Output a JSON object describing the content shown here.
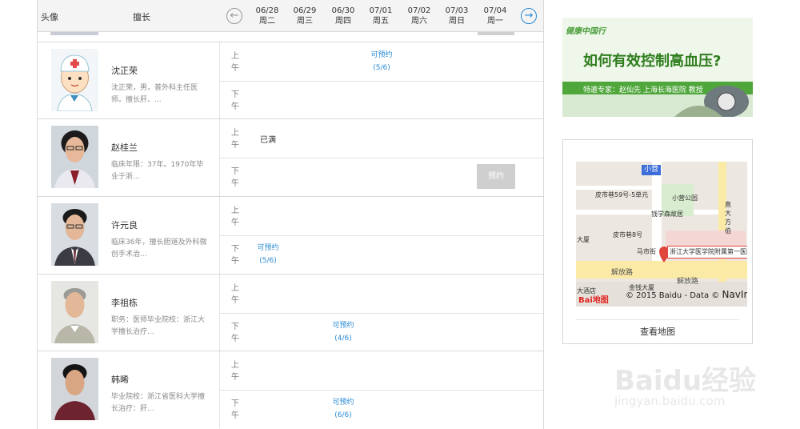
{
  "header": {
    "avatar_label": "头像",
    "expert_label": "擅长",
    "prev_icon": "arrow-left-circle-icon",
    "next_icon": "arrow-right-circle-icon",
    "days": [
      {
        "date": "06/28",
        "weekday": "周二"
      },
      {
        "date": "06/29",
        "weekday": "周三"
      },
      {
        "date": "06/30",
        "weekday": "周四"
      },
      {
        "date": "07/01",
        "weekday": "周五"
      },
      {
        "date": "07/02",
        "weekday": "周六"
      },
      {
        "date": "07/03",
        "weekday": "周日"
      },
      {
        "date": "07/04",
        "weekday": "周一"
      }
    ]
  },
  "labels": {
    "am": "上午",
    "pm": "下午"
  },
  "doctors": [
    {
      "name": "沈正荣",
      "desc": "沈正荣，男，普外科主任医师。擅长肝、...",
      "am_slot": {
        "label": "可预约",
        "count": "(5/6)"
      }
    },
    {
      "name": "赵桂兰",
      "desc": "临床年限：37年。1970年毕业于浙...",
      "am_status": "已满",
      "pm_button": "预约"
    },
    {
      "name": "许元良",
      "desc": "临床36年，擅长胆道及外科微创手术治...",
      "pm_slot": {
        "label": "可预约",
        "count": "(5/6)"
      }
    },
    {
      "name": "李祖栋",
      "desc": "职务：医师毕业院校：浙江大学擅长治疗...",
      "pm_slot": {
        "label": "可预约",
        "count": "(4/6)"
      }
    },
    {
      "name": "韩晞",
      "desc": "毕业院校：浙江省医科大学擅长治疗：肝...",
      "pm_slot": {
        "label": "可预约",
        "count": "(6/6)"
      }
    }
  ],
  "ad": {
    "logo": "健康中国行",
    "title": "如何有效控制高血压?",
    "expert": "特邀专家：赵仙先 上海长海医院 教授"
  },
  "map": {
    "station": "小营",
    "labels": [
      "皮市巷59号-5单元",
      "小营公园",
      "钱学森故居",
      "皮市巷8号",
      "马市街",
      "大厦",
      "直大方伯",
      "解放路",
      "解放路",
      "大酒店",
      "金钱大厦"
    ],
    "popup": "浙江大学医学院附属第一医院",
    "copyright": "© 2015 Baidu - Data ©",
    "navinfo": "NavInfo",
    "logo": "Bai地图",
    "link": "查看地图"
  },
  "watermark": {
    "text": "Baidu经验",
    "url": "jingyan.baidu.com"
  },
  "colors": {
    "link": "#2a8ad4",
    "button": "#cfcfcf",
    "header_bg": "#f4f4f4",
    "ad_green": "#2f7d1e",
    "map_pin": "#e0463c"
  }
}
